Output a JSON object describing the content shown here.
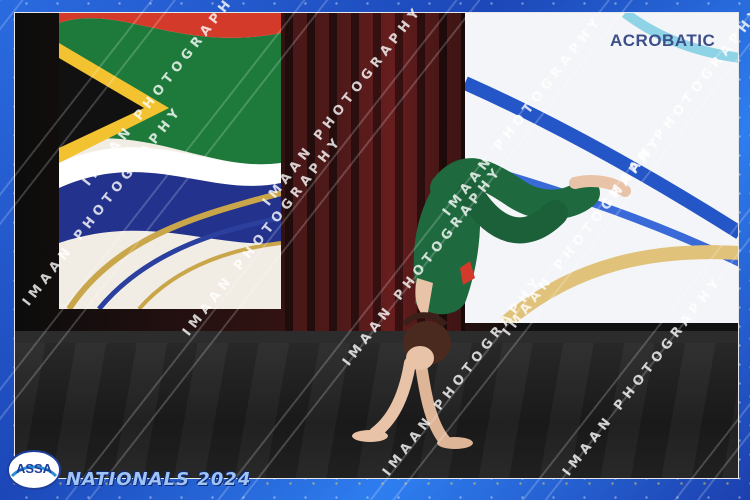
{
  "banner": {
    "title": "ACROBATIC"
  },
  "watermark": {
    "text": "IMAAN PHOTOGRAPHY"
  },
  "logo": {
    "text": "ASSA"
  },
  "footer": {
    "text": "NATIONALS 2024"
  },
  "colors": {
    "frame_blue": "#1f55c9",
    "leotard_green": "#1e6a3e",
    "flag_red": "#d43a2a",
    "flag_green": "#1d7a3a",
    "flag_yellow": "#f2c230",
    "flag_blue": "#23328c"
  }
}
